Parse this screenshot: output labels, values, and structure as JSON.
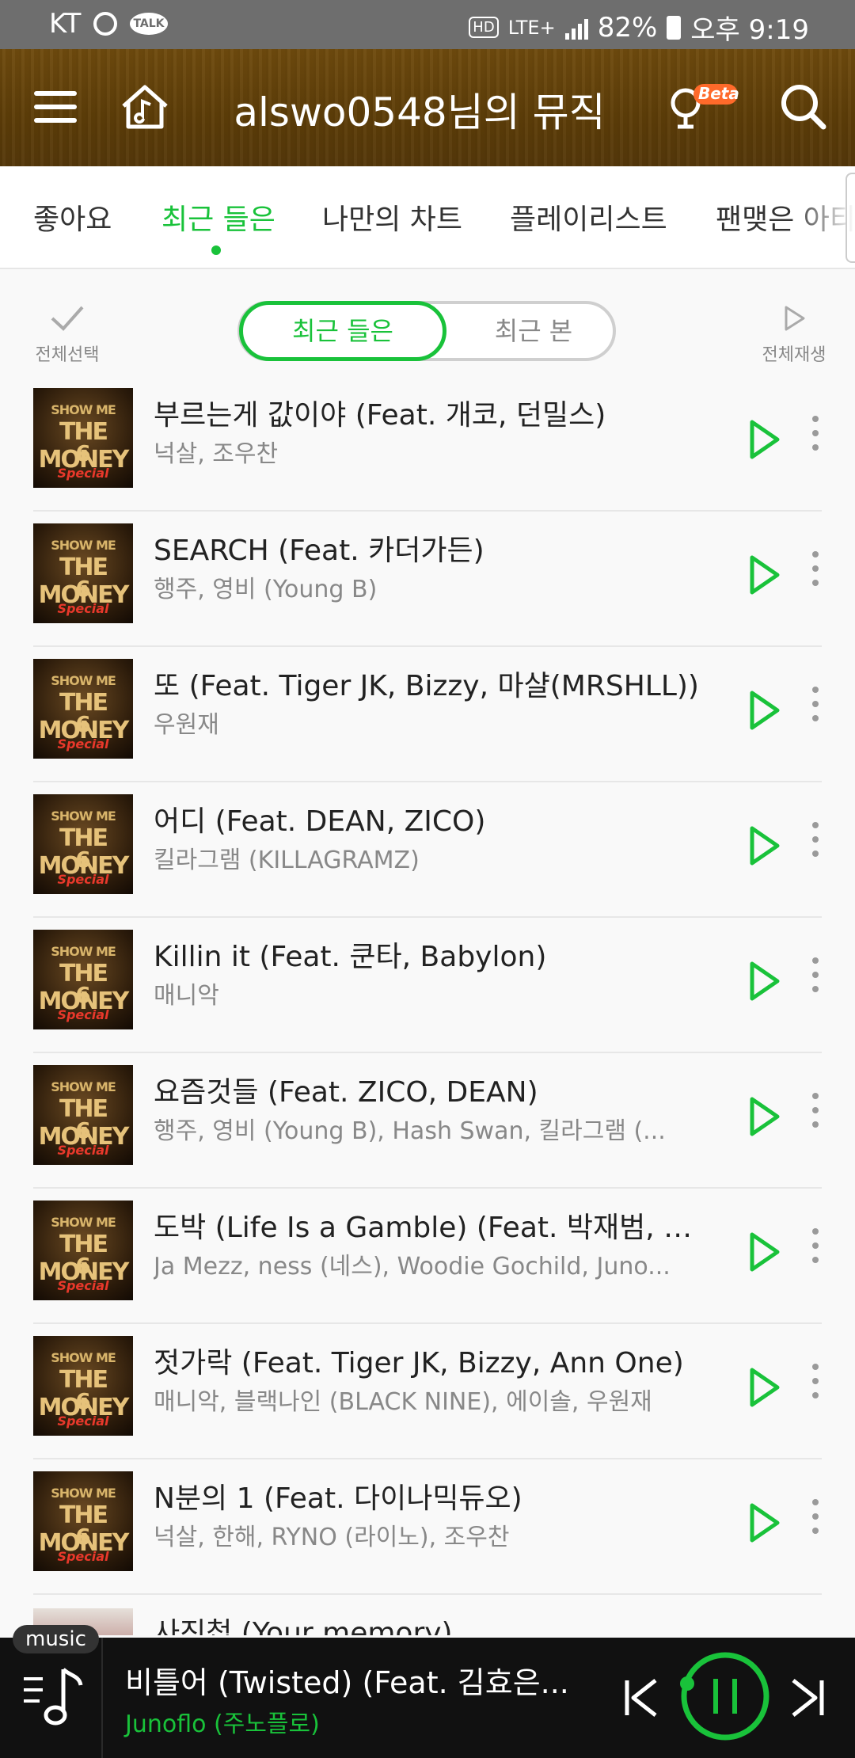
{
  "status_bar": {
    "carrier": "KT",
    "talk": "TALK",
    "hd": "HD",
    "network": "LTE+",
    "battery": "82%",
    "time": "오후 9:19"
  },
  "header": {
    "title": "alswo0548님의 뮤직",
    "beta_label": "Beta"
  },
  "tabs": [
    {
      "label": "좋아요"
    },
    {
      "label": "최근 들은"
    },
    {
      "label": "나만의 차트"
    },
    {
      "label": "플레이리스트"
    },
    {
      "label": "팬맺은 아티"
    }
  ],
  "active_tab": "최근 들은",
  "controls": {
    "select_all": "전체선택",
    "segment_on": "최근 들은",
    "segment_off": "최근 본",
    "play_all": "전체재생"
  },
  "album_art": {
    "line1": "SHOW ME",
    "line2": "THE MONEY",
    "line3": "6",
    "line4": "Special"
  },
  "songs": [
    {
      "title": "부르는게 값이야 (Feat. 개코, 던밀스)",
      "artist": "넉살, 조우찬"
    },
    {
      "title": "SEARCH (Feat. 카더가든)",
      "artist": "행주, 영비 (Young B)"
    },
    {
      "title": "또 (Feat. Tiger JK, Bizzy, 마샬(MRSHLL))",
      "artist": "우원재"
    },
    {
      "title": "어디 (Feat. DEAN, ZICO)",
      "artist": "킬라그램 (KILLAGRAMZ)"
    },
    {
      "title": "Killin it (Feat. 쿤타, Babylon)",
      "artist": "매니악"
    },
    {
      "title": "요즘것들 (Feat. ZICO, DEAN)",
      "artist": "행주, 영비 (Young B), Hash Swan, 킬라그램 (..."
    },
    {
      "title": "도박 (Life Is a Gamble) (Feat. 박재범, D...",
      "artist": "Ja Mezz, ness (네스), Woodie Gochild, Juno..."
    },
    {
      "title": "젓가락 (Feat. Tiger JK, Bizzy, Ann One)",
      "artist": "매니악, 블랙나인 (BLACK NINE), 에이솔, 우원재"
    },
    {
      "title": "N분의 1 (Feat. 다이나믹듀오)",
      "artist": "넉살, 한해, RYNO (라이노), 조우찬"
    }
  ],
  "partial_song": {
    "title": "사진첩 (Your memory)"
  },
  "mini_player": {
    "tag": "music",
    "title": "비틀어 (Twisted) (Feat. 김효은...",
    "artist": "Junoflo (주노플로)"
  },
  "colors": {
    "accent": "#19c23a",
    "header_bg": "#5d3d08",
    "status_bar": "#6e6e6e",
    "player_bg": "#111111"
  },
  "icons": {
    "header": [
      "menu-icon",
      "home-music-icon",
      "voice-search-icon",
      "search-icon"
    ],
    "row": [
      "play-icon",
      "more-vertical-icon"
    ],
    "player": [
      "playlist-music-icon",
      "previous-icon",
      "pause-icon",
      "next-icon"
    ]
  }
}
